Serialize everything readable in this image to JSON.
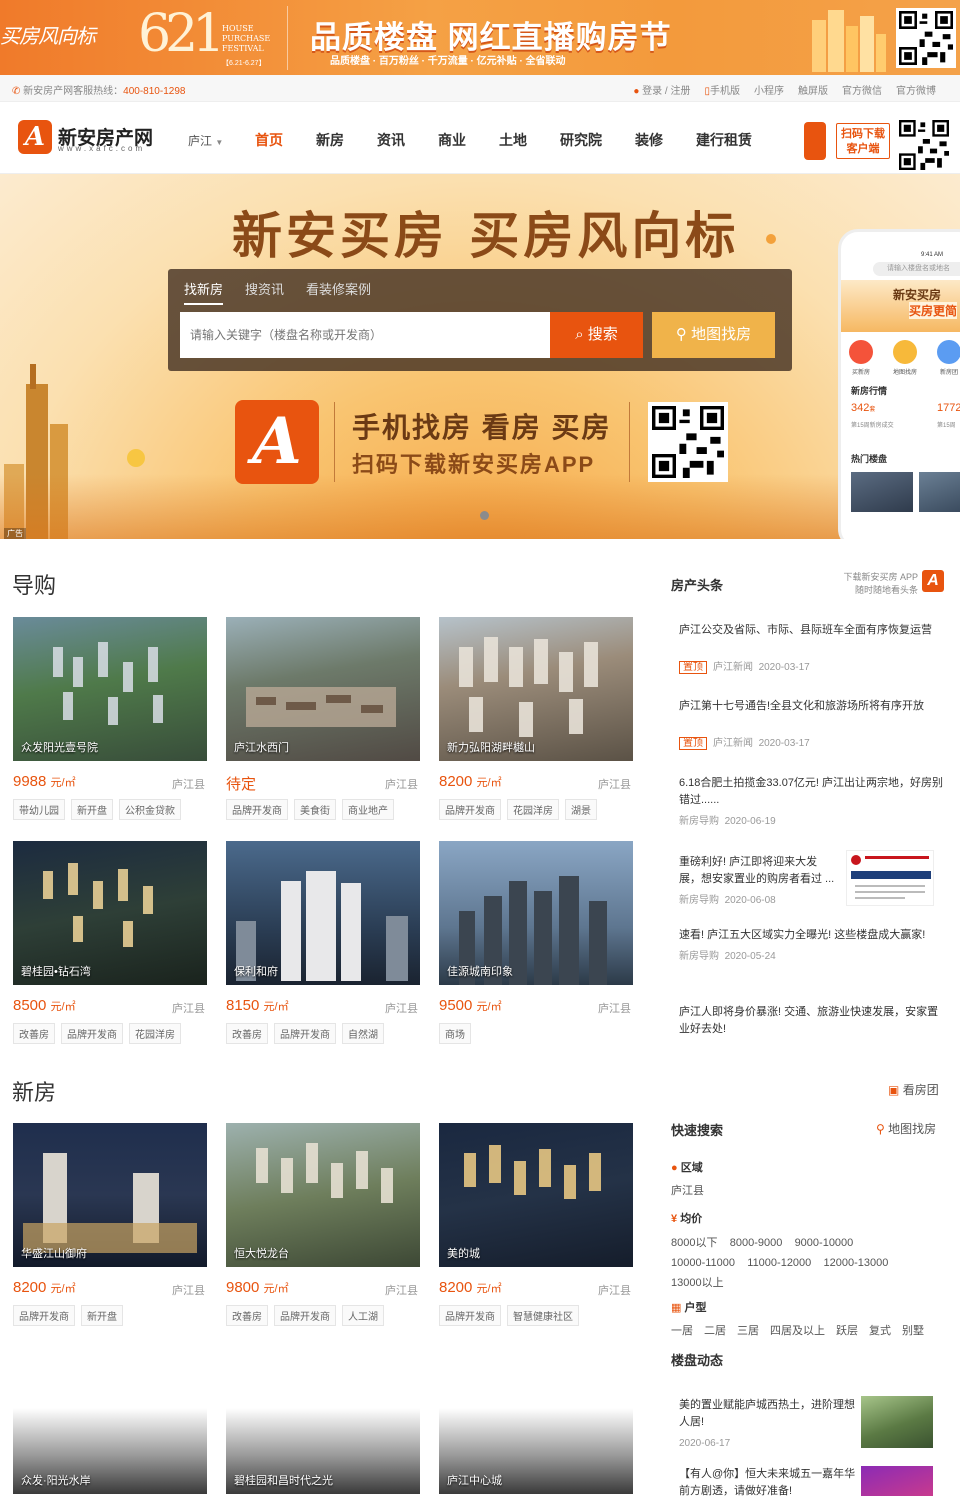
{
  "top_banner": {
    "left_text": "买房风向标",
    "festival_num": "621",
    "festival_text": "HOUSE PURCHASE FESTIVAL",
    "festival_date": "【6.21-6.27】",
    "title": "品质楼盘 网红直播购房节",
    "subtitle": "品质楼盘 · 百万粉丝 · 千万流量 · 亿元补贴 · 全省联动"
  },
  "info_bar": {
    "hotline_label": "新安房产网客服热线：",
    "hotline": "400-810-1298",
    "links": [
      "登录 / 注册",
      "手机版",
      "小程序",
      "触屏版",
      "官方微信",
      "官方微博"
    ]
  },
  "header": {
    "logo_letter": "A",
    "logo_name": "新安房产网",
    "logo_url": "www.xafc.com",
    "city": "庐江",
    "nav": [
      "首页",
      "新房",
      "资讯",
      "商业",
      "土地",
      "研究院",
      "装修",
      "建行租赁"
    ],
    "download_label": "扫码下载 客户端"
  },
  "hero": {
    "title": "新安买房 买房风向标",
    "tabs": [
      "找新房",
      "搜资讯",
      "看装修案例"
    ],
    "search_placeholder": "请输入关键字（楼盘名称或开发商）",
    "search_button": "搜索",
    "map_button": "地图找房",
    "app_line1": "手机找房 看房 买房",
    "app_line2": "扫码下载新安买房APP",
    "ad_label": "广告",
    "phone": {
      "time": "9:41 AM",
      "search": "请输入楼盘名或地名",
      "banner1": "新安买房",
      "banner2": "买房更简",
      "icons": [
        "买新房",
        "地图找房",
        "新房团"
      ],
      "market_title": "新房行情",
      "value1": "342",
      "value1_unit": "套",
      "value2": "1772",
      "value1_label": "第15周新房成交",
      "value2_label": "第15周",
      "hot_title": "热门楼盘"
    }
  },
  "guide": {
    "title": "导购",
    "cards": [
      {
        "name": "众发阳光壹号院",
        "price": "9988",
        "unit": "元/㎡",
        "area": "庐江县",
        "tags": [
          "带幼儿园",
          "新开盘",
          "公积金贷款"
        ]
      },
      {
        "name": "庐江水西门",
        "price": "待定",
        "unit": "",
        "area": "庐江县",
        "tags": [
          "品牌开发商",
          "美食街",
          "商业地产"
        ]
      },
      {
        "name": "新力弘阳湖畔樾山",
        "price": "8200",
        "unit": "元/㎡",
        "area": "庐江县",
        "tags": [
          "品牌开发商",
          "花园洋房",
          "湖景"
        ]
      },
      {
        "name": "碧桂园•钻石湾",
        "price": "8500",
        "unit": "元/㎡",
        "area": "庐江县",
        "tags": [
          "改善房",
          "品牌开发商",
          "花园洋房"
        ]
      },
      {
        "name": "保利和府",
        "price": "8150",
        "unit": "元/㎡",
        "area": "庐江县",
        "tags": [
          "改善房",
          "品牌开发商",
          "自然湖"
        ]
      },
      {
        "name": "佳源城南印象",
        "price": "9500",
        "unit": "元/㎡",
        "area": "庐江县",
        "tags": [
          "商场"
        ]
      }
    ]
  },
  "newhouse": {
    "title": "新房",
    "tour_label": "看房团",
    "cards": [
      {
        "name": "华盛江山御府",
        "price": "8200",
        "unit": "元/㎡",
        "area": "庐江县",
        "tags": [
          "品牌开发商",
          "新开盘"
        ]
      },
      {
        "name": "恒大悦龙台",
        "price": "9800",
        "unit": "元/㎡",
        "area": "庐江县",
        "tags": [
          "改善房",
          "品牌开发商",
          "人工湖"
        ]
      },
      {
        "name": "美的城",
        "price": "8200",
        "unit": "元/㎡",
        "area": "庐江县",
        "tags": [
          "品牌开发商",
          "智慧健康社区"
        ]
      },
      {
        "name": "众发·阳光水岸"
      },
      {
        "name": "碧桂园和昌时代之光"
      },
      {
        "name": "庐江中心城"
      }
    ]
  },
  "headlines": {
    "title": "房产头条",
    "app_promo1": "下载新安买房 APP",
    "app_promo2": "随时随地看头条",
    "items": [
      {
        "title": "庐江公交及省际、市际、县际班车全面有序恢复运营",
        "tag": "置顶",
        "source": "庐江新闻",
        "date": "2020-03-17"
      },
      {
        "title": "庐江第十七号通告!全县文化和旅游场所将有序开放",
        "tag": "置顶",
        "source": "庐江新闻",
        "date": "2020-03-17"
      },
      {
        "title": "6.18合肥土拍揽金33.07亿元! 庐江出让两宗地，好房别错过......",
        "source": "新房导购",
        "date": "2020-06-19"
      },
      {
        "title": "重磅利好! 庐江即将迎来大发展，想安家置业的购房者看过 ...",
        "source": "新房导购",
        "date": "2020-06-08"
      },
      {
        "title": "速看! 庐江五大区域实力全曝光! 这些楼盘成大赢家!",
        "source": "新房导购",
        "date": "2020-05-24"
      },
      {
        "title": "庐江人即将身价暴涨! 交通、旅游业快速发展，安家置业好去处!"
      }
    ]
  },
  "quick_search": {
    "title": "快速搜索",
    "map_label": "地图找房",
    "region_label": "区域",
    "region_values": [
      "庐江县"
    ],
    "price_label": "均价",
    "price_values": [
      "8000以下",
      "8000-9000",
      "9000-10000",
      "10000-11000",
      "11000-12000",
      "12000-13000",
      "13000以上"
    ],
    "layout_label": "户型",
    "layout_values": [
      "一居",
      "二居",
      "三居",
      "四居及以上",
      "跃层",
      "复式",
      "别墅"
    ]
  },
  "dynamics": {
    "title": "楼盘动态",
    "items": [
      {
        "title": "美的置业赋能庐城西热土，进阶理想人居!",
        "date": "2020-06-17"
      },
      {
        "title": "【有人@你】恒大未来城五一嘉年华前方剧透，请做好准备!"
      }
    ]
  },
  "colors": {
    "accent": "#e8540f",
    "gold": "#f0b34a"
  }
}
